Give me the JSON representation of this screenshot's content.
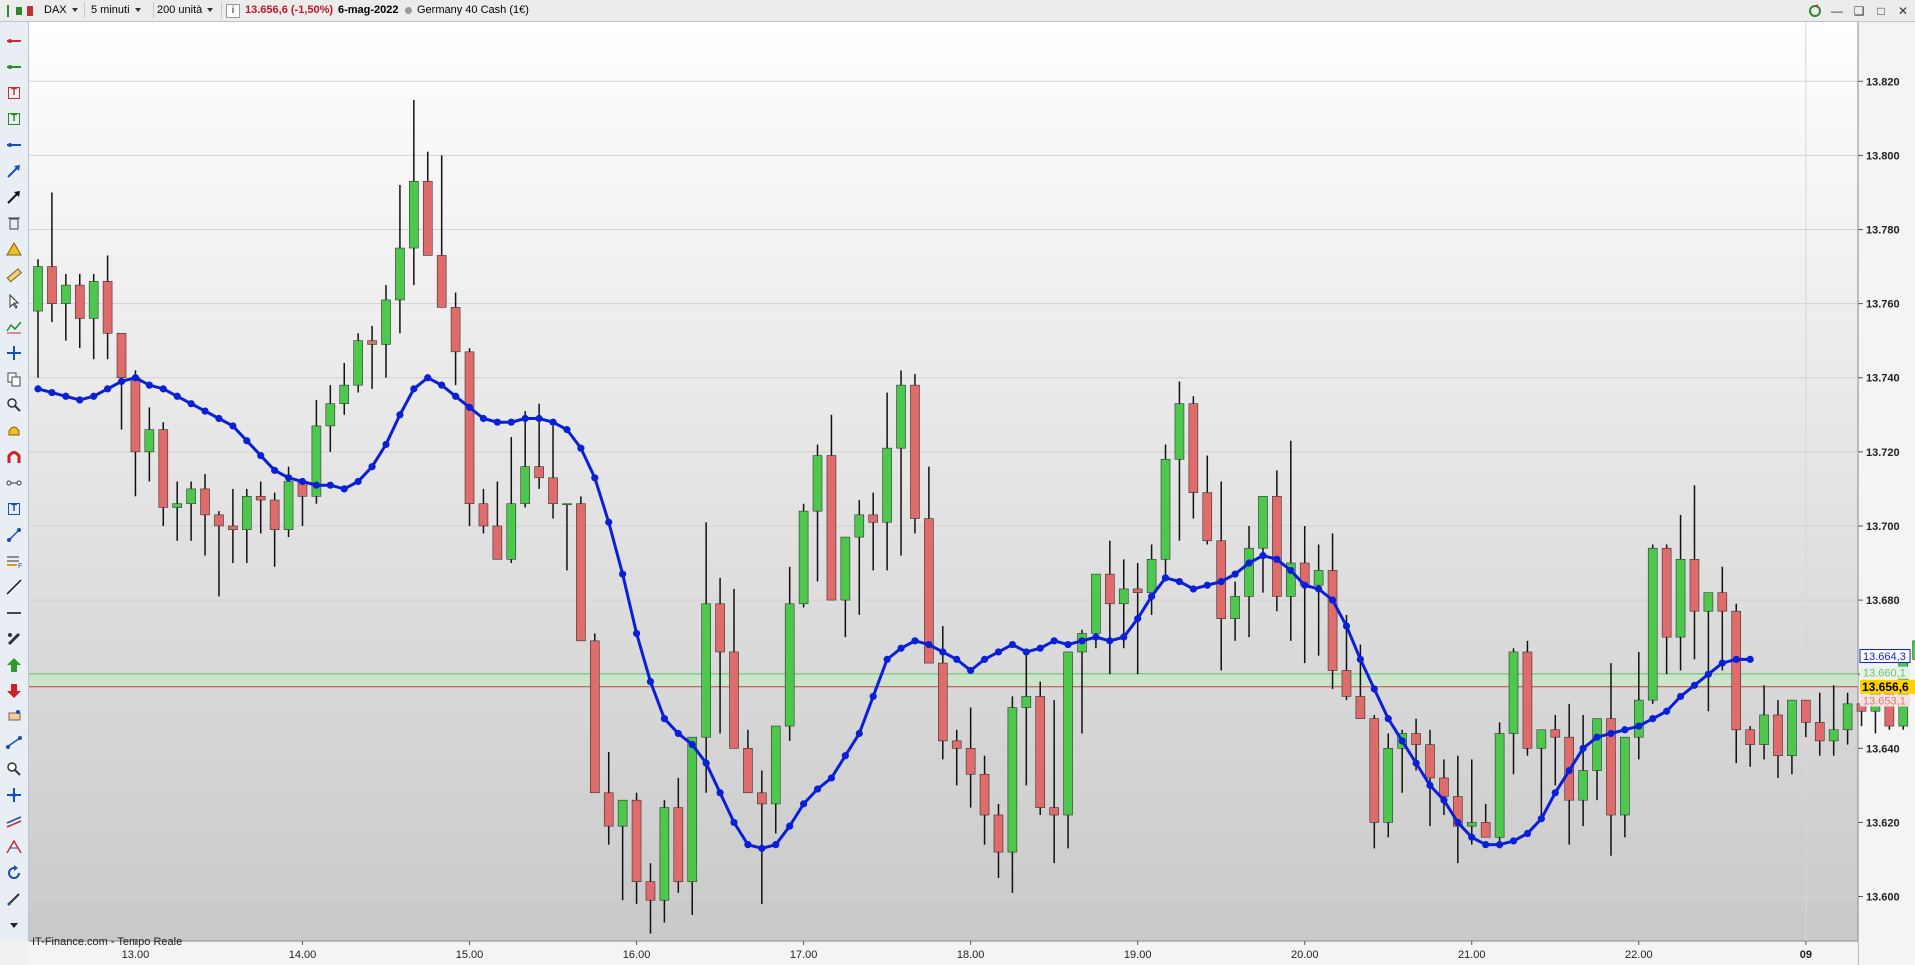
{
  "toolbar": {
    "symbol": "DAX",
    "interval": "5 minuti",
    "units": "200 unità",
    "price_change": "13.656,6 (-1,50%)",
    "date": "6-mag-2022",
    "instrument": "Germany 40 Cash (1€)"
  },
  "footer": {
    "source": "IT-Finance.com - Tempo Reale"
  },
  "price_badges": {
    "ma": "13.664,3",
    "upper": "13.660,1",
    "last": "13.656,6",
    "lower": "13.653,1"
  },
  "colors": {
    "up": "#4cc94c",
    "down": "#e06b6b",
    "ma": "#0a1fd8",
    "band": "#c9e6c9",
    "last_badge": "#ffd200"
  },
  "left_tools": [
    "line-icon",
    "horizontal-line-icon",
    "text-icon",
    "text-icon-2",
    "horizontal-ray-icon",
    "arrow-icon",
    "black-arrow-icon",
    "trash-icon",
    "warning-icon",
    "ruler-icon",
    "cursor-icon",
    "zigzag-icon",
    "crosshair-icon",
    "copy-icon",
    "zoom-icon",
    "alarm-icon",
    "magnet-icon",
    "node-line-icon",
    "text-box-icon",
    "fork-icon",
    "fibonacci-icon",
    "trendline-icon",
    "separator-icon",
    "settings-icon",
    "buy-arrow-icon",
    "sell-arrow-icon",
    "order-icon",
    "dot-line-icon",
    "magnifier-icon",
    "move-icon",
    "channel-icon",
    "pitchfork-icon",
    "refresh-icon",
    "pencil-icon",
    "more-icon"
  ],
  "chart_data": {
    "type": "candlestick",
    "y_ticks": [
      "13.600",
      "13.620",
      "13.640",
      "13.660",
      "13.680",
      "13.700",
      "13.720",
      "13.740",
      "13.760",
      "13.780",
      "13.800",
      "13.820"
    ],
    "ylim": [
      13588,
      13836
    ],
    "x_ticks": [
      {
        "label": "13.00",
        "i": 7
      },
      {
        "label": "14.00",
        "i": 19
      },
      {
        "label": "15.00",
        "i": 31
      },
      {
        "label": "16.00",
        "i": 43
      },
      {
        "label": "17.00",
        "i": 55
      },
      {
        "label": "18.00",
        "i": 67
      },
      {
        "label": "19.00",
        "i": 79
      },
      {
        "label": "20.00",
        "i": 91
      },
      {
        "label": "21.00",
        "i": 103
      },
      {
        "label": "22.00",
        "i": 115
      },
      {
        "label": "09",
        "i": 127
      }
    ],
    "ohlc": [
      [
        13758,
        13772,
        13740,
        13770
      ],
      [
        13770,
        13790,
        13755,
        13760
      ],
      [
        13760,
        13768,
        13750,
        13765
      ],
      [
        13765,
        13768,
        13748,
        13756
      ],
      [
        13756,
        13768,
        13745,
        13766
      ],
      [
        13766,
        13773,
        13745,
        13752
      ],
      [
        13752,
        13752,
        13726,
        13740
      ],
      [
        13740,
        13742,
        13708,
        13720
      ],
      [
        13720,
        13732,
        13712,
        13726
      ],
      [
        13726,
        13728,
        13700,
        13705
      ],
      [
        13705,
        13712,
        13696,
        13706
      ],
      [
        13706,
        13712,
        13696,
        13710
      ],
      [
        13710,
        13714,
        13692,
        13703
      ],
      [
        13703,
        13704,
        13681,
        13700
      ],
      [
        13700,
        13710,
        13690,
        13699
      ],
      [
        13699,
        13710,
        13690,
        13708
      ],
      [
        13708,
        13712,
        13698,
        13707
      ],
      [
        13707,
        13709,
        13689,
        13699
      ],
      [
        13699,
        13716,
        13697,
        13712
      ],
      [
        13712,
        13712,
        13700,
        13708
      ],
      [
        13708,
        13734,
        13706,
        13727
      ],
      [
        13727,
        13738,
        13720,
        13733
      ],
      [
        13733,
        13744,
        13730,
        13738
      ],
      [
        13738,
        13752,
        13736,
        13750
      ],
      [
        13750,
        13754,
        13737,
        13749
      ],
      [
        13749,
        13765,
        13740,
        13761
      ],
      [
        13761,
        13792,
        13752,
        13775
      ],
      [
        13775,
        13815,
        13765,
        13793
      ],
      [
        13793,
        13801,
        13784,
        13773
      ],
      [
        13773,
        13800,
        13762,
        13759
      ],
      [
        13759,
        13763,
        13738,
        13747
      ],
      [
        13747,
        13748,
        13700,
        13706
      ],
      [
        13706,
        13710,
        13698,
        13700
      ],
      [
        13700,
        13712,
        13692,
        13691
      ],
      [
        13691,
        13724,
        13690,
        13706
      ],
      [
        13706,
        13731,
        13705,
        13716
      ],
      [
        13716,
        13733,
        13710,
        13713
      ],
      [
        13713,
        13727,
        13702,
        13706
      ],
      [
        13706,
        13706,
        13688,
        13706
      ],
      [
        13706,
        13708,
        13669,
        13669
      ],
      [
        13669,
        13671,
        13632,
        13628
      ],
      [
        13628,
        13639,
        13614,
        13619
      ],
      [
        13619,
        13626,
        13599,
        13626
      ],
      [
        13626,
        13628,
        13598,
        13604
      ],
      [
        13604,
        13609,
        13590,
        13599
      ],
      [
        13599,
        13626,
        13593,
        13624
      ],
      [
        13624,
        13632,
        13601,
        13604
      ],
      [
        13604,
        13643,
        13595,
        13643
      ],
      [
        13643,
        13701,
        13628,
        13679
      ],
      [
        13679,
        13686,
        13644,
        13666
      ],
      [
        13666,
        13683,
        13644,
        13640
      ],
      [
        13640,
        13645,
        13628,
        13628
      ],
      [
        13628,
        13634,
        13598,
        13625
      ],
      [
        13625,
        13632,
        13617,
        13646
      ],
      [
        13646,
        13689,
        13642,
        13679
      ],
      [
        13679,
        13706,
        13678,
        13704
      ],
      [
        13704,
        13722,
        13685,
        13719
      ],
      [
        13719,
        13730,
        13690,
        13680
      ],
      [
        13680,
        13688,
        13670,
        13697
      ],
      [
        13697,
        13707,
        13676,
        13703
      ],
      [
        13703,
        13709,
        13688,
        13701
      ],
      [
        13701,
        13736,
        13688,
        13721
      ],
      [
        13721,
        13742,
        13692,
        13738
      ],
      [
        13738,
        13741,
        13698,
        13702
      ],
      [
        13702,
        13716,
        13677,
        13663
      ],
      [
        13663,
        13673,
        13637,
        13642
      ],
      [
        13642,
        13645,
        13630,
        13640
      ],
      [
        13640,
        13651,
        13624,
        13633
      ],
      [
        13633,
        13638,
        13614,
        13622
      ],
      [
        13622,
        13625,
        13605,
        13612
      ],
      [
        13612,
        13654,
        13601,
        13651
      ],
      [
        13651,
        13666,
        13630,
        13654
      ],
      [
        13654,
        13658,
        13622,
        13624
      ],
      [
        13624,
        13653,
        13609,
        13622
      ],
      [
        13622,
        13665,
        13613,
        13666
      ],
      [
        13666,
        13672,
        13644,
        13671
      ],
      [
        13671,
        13682,
        13667,
        13687
      ],
      [
        13687,
        13696,
        13660,
        13679
      ],
      [
        13679,
        13691,
        13667,
        13683
      ],
      [
        13683,
        13690,
        13660,
        13682
      ],
      [
        13682,
        13695,
        13676,
        13691
      ],
      [
        13691,
        13722,
        13685,
        13718
      ],
      [
        13718,
        13739,
        13696,
        13733
      ],
      [
        13733,
        13735,
        13702,
        13709
      ],
      [
        13709,
        13719,
        13695,
        13696
      ],
      [
        13696,
        13712,
        13661,
        13675
      ],
      [
        13675,
        13685,
        13669,
        13681
      ],
      [
        13681,
        13700,
        13670,
        13694
      ],
      [
        13694,
        13706,
        13682,
        13708
      ],
      [
        13708,
        13715,
        13677,
        13681
      ],
      [
        13681,
        13723,
        13669,
        13690
      ],
      [
        13690,
        13700,
        13663,
        13684
      ],
      [
        13684,
        13695,
        13665,
        13688
      ],
      [
        13688,
        13698,
        13656,
        13661
      ],
      [
        13661,
        13676,
        13653,
        13654
      ],
      [
        13654,
        13668,
        13652,
        13648
      ],
      [
        13648,
        13649,
        13613,
        13620
      ],
      [
        13620,
        13644,
        13616,
        13640
      ],
      [
        13640,
        13645,
        13628,
        13644
      ],
      [
        13644,
        13648,
        13634,
        13641
      ],
      [
        13641,
        13645,
        13619,
        13632
      ],
      [
        13632,
        13637,
        13622,
        13627
      ],
      [
        13627,
        13638,
        13609,
        13619
      ],
      [
        13619,
        13637,
        13614,
        13620
      ],
      [
        13620,
        13625,
        13616,
        13616
      ],
      [
        13616,
        13647,
        13613,
        13644
      ],
      [
        13644,
        13667,
        13633,
        13666
      ],
      [
        13666,
        13669,
        13638,
        13640
      ],
      [
        13640,
        13642,
        13621,
        13645
      ],
      [
        13645,
        13649,
        13630,
        13643
      ],
      [
        13643,
        13652,
        13614,
        13626
      ],
      [
        13626,
        13649,
        13619,
        13634
      ],
      [
        13634,
        13647,
        13626,
        13648
      ],
      [
        13648,
        13663,
        13611,
        13622
      ],
      [
        13622,
        13641,
        13616,
        13643
      ],
      [
        13643,
        13666,
        13637,
        13653
      ],
      [
        13653,
        13695,
        13652,
        13694
      ],
      [
        13694,
        13695,
        13660,
        13670
      ],
      [
        13670,
        13703,
        13661,
        13691
      ],
      [
        13691,
        13711,
        13664,
        13677
      ],
      [
        13677,
        13681,
        13650,
        13682
      ],
      [
        13682,
        13689,
        13661,
        13677
      ],
      [
        13677,
        13679,
        13636,
        13645
      ],
      [
        13645,
        13646,
        13635,
        13641
      ],
      [
        13641,
        13657,
        13637,
        13649
      ],
      [
        13649,
        13653,
        13632,
        13638
      ],
      [
        13638,
        13651,
        13633,
        13653
      ],
      [
        13653,
        13653,
        13643,
        13647
      ],
      [
        13647,
        13655,
        13638,
        13642
      ],
      [
        13642,
        13657,
        13638,
        13645
      ],
      [
        13645,
        13655,
        13641,
        13652
      ],
      [
        13652,
        13650,
        13646,
        13650
      ],
      [
        13650,
        13655,
        13644,
        13655
      ],
      [
        13655,
        13656,
        13645,
        13646
      ],
      [
        13646,
        13666,
        13645,
        13664
      ],
      [
        13664,
        13669,
        13659,
        13669
      ],
      [
        13669,
        13669,
        13654,
        13656
      ]
    ],
    "ma": [
      13737,
      13736,
      13735,
      13734,
      13735,
      13737,
      13739,
      13740,
      13738,
      13737,
      13735,
      13733,
      13731,
      13729,
      13727,
      13723,
      13719,
      13715,
      13713,
      13712,
      13711,
      13711,
      13710,
      13712,
      13716,
      13722,
      13730,
      13737,
      13740,
      13738,
      13735,
      13732,
      13729,
      13728,
      13728,
      13729,
      13729,
      13728,
      13726,
      13721,
      13713,
      13701,
      13687,
      13671,
      13658,
      13648,
      13644,
      13641,
      13636,
      13628,
      13620,
      13614,
      13613,
      13614,
      13619,
      13625,
      13629,
      13632,
      13638,
      13644,
      13654,
      13664,
      13667,
      13669,
      13668,
      13666,
      13664,
      13661,
      13664,
      13666,
      13668,
      13666,
      13667,
      13669,
      13668,
      13669,
      13670,
      13669,
      13670,
      13675,
      13681,
      13686,
      13685,
      13683,
      13684,
      13685,
      13687,
      13690,
      13692,
      13691,
      13688,
      13684,
      13683,
      13680,
      13673,
      13664,
      13656,
      13648,
      13642,
      13636,
      13630,
      13626,
      13620,
      13616,
      13614,
      13614,
      13615,
      13617,
      13621,
      13628,
      13634,
      13640,
      13643,
      13644,
      13645,
      13646,
      13648,
      13650,
      13654,
      13657,
      13660,
      13663,
      13664,
      13664
    ]
  }
}
